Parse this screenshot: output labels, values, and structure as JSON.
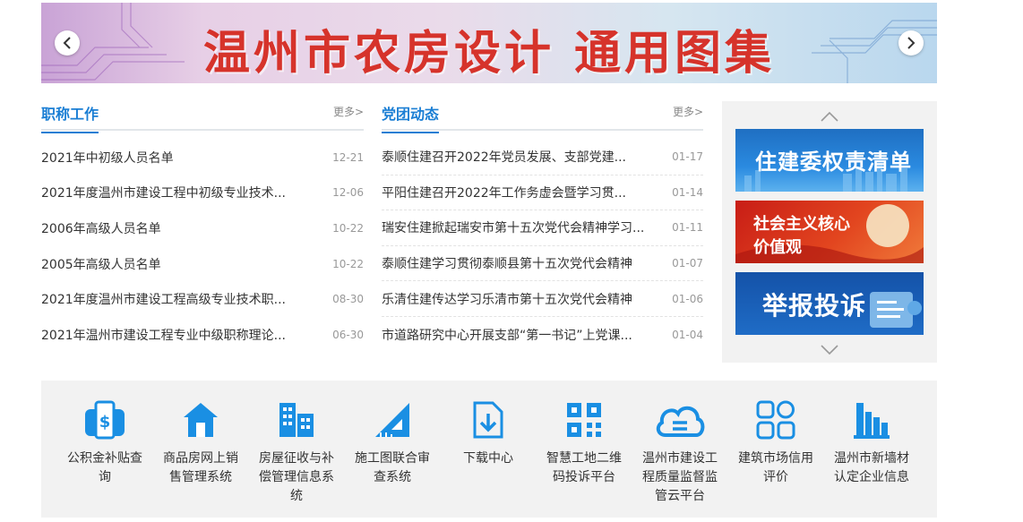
{
  "banner": {
    "title": "温州市农房设计 通用图集",
    "prev_icon": "chevron-left-icon",
    "next_icon": "chevron-right-icon"
  },
  "zhicheng": {
    "title": "职称工作",
    "more": "更多>",
    "items": [
      {
        "title": "2021年中初级人员名单",
        "date": "12-21"
      },
      {
        "title": "2021年度温州市建设工程中初级专业技术...",
        "date": "12-06"
      },
      {
        "title": "2006年高级人员名单",
        "date": "10-22"
      },
      {
        "title": "2005年高级人员名单",
        "date": "10-22"
      },
      {
        "title": "2021年度温州市建设工程高级专业技术职...",
        "date": "08-30"
      },
      {
        "title": "2021年温州市建设工程专业中级职称理论...",
        "date": "06-30"
      }
    ]
  },
  "dangtuan": {
    "title": "党团动态",
    "more": "更多>",
    "items": [
      {
        "title": "泰顺住建召开2022年党员发展、支部党建...",
        "date": "01-17"
      },
      {
        "title": "平阳住建召开2022年工作务虚会暨学习贯...",
        "date": "01-14"
      },
      {
        "title": "瑞安住建掀起瑞安市第十五次党代会精神学习...",
        "date": "01-11"
      },
      {
        "title": "泰顺住建学习贯彻泰顺县第十五次党代会精神",
        "date": "01-07"
      },
      {
        "title": "乐清住建传达学习乐清市第十五次党代会精神",
        "date": "01-06"
      },
      {
        "title": "市道路研究中心开展支部“第一书记”上党课...",
        "date": "01-04"
      }
    ]
  },
  "side": {
    "promos": [
      {
        "text": "住建委权责清单"
      },
      {
        "text_line1": "社会主义核心",
        "text_line2": "价值观"
      },
      {
        "text": "举报投诉"
      }
    ]
  },
  "services": [
    {
      "icon": "wallet-icon",
      "label": "公积金补贴查询"
    },
    {
      "icon": "house-icon",
      "label": "商品房网上销售管理系统"
    },
    {
      "icon": "buildings-icon",
      "label": "房屋征收与补偿管理信息系统"
    },
    {
      "icon": "set-square-icon",
      "label": "施工图联合审查系统"
    },
    {
      "icon": "download-icon",
      "label": "下载中心"
    },
    {
      "icon": "qr-code-icon",
      "label": "智慧工地二维码投诉平台"
    },
    {
      "icon": "cloud-icon",
      "label": "温州市建设工程质量监督监管云平台"
    },
    {
      "icon": "grid-apps-icon",
      "label": "建筑市场信用评价"
    },
    {
      "icon": "factory-icon",
      "label": "温州市新墙材认定企业信息"
    }
  ],
  "colors": {
    "accent": "#1a7ed4",
    "banner_title": "#d6332b",
    "icon_blue": "#1a8fe3"
  }
}
